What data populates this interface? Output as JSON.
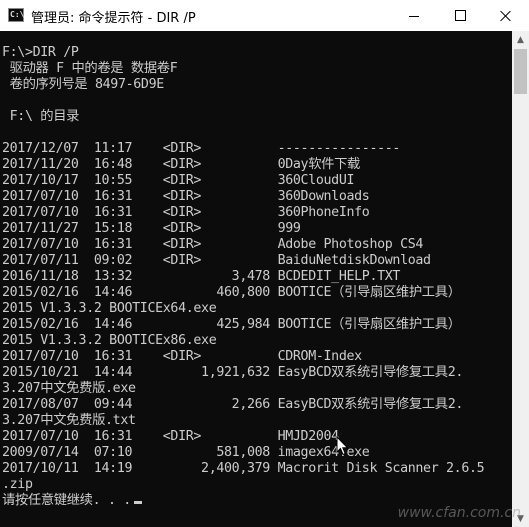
{
  "window": {
    "title": "管理员: 命令提示符 - DIR  /P",
    "icon": "cmd-icon",
    "icon_text": "C:\\",
    "min_icon": "minimize-icon",
    "max_icon": "maximize-icon",
    "close_icon": "close-icon"
  },
  "console": {
    "lines": [
      "F:\\>DIR /P",
      " 驱动器 F 中的卷是 数据卷F",
      " 卷的序列号是 8497-6D9E",
      "",
      " F:\\ 的目录",
      "",
      "2017/12/07  11:17    <DIR>          ----------------",
      "2017/11/20  16:48    <DIR>          0Day软件下载",
      "2017/10/17  10:55    <DIR>          360CloudUI",
      "2017/07/10  16:31    <DIR>          360Downloads",
      "2017/07/10  16:31    <DIR>          360PhoneInfo",
      "2017/11/27  15:18    <DIR>          999",
      "2017/07/10  16:31    <DIR>          Adobe Photoshop CS4",
      "2017/07/11  09:02    <DIR>          BaiduNetdiskDownload",
      "2016/11/18  13:32             3,478 BCDEDIT_HELP.TXT",
      "2015/02/16  14:46           460,800 BOOTICE（引导扇区维护工具）",
      "2015 V1.3.3.2 BOOTICEx64.exe",
      "2015/02/16  14:46           425,984 BOOTICE（引导扇区维护工具）",
      "2015 V1.3.3.2 BOOTICEx86.exe",
      "2017/07/10  16:31    <DIR>          CDROM-Index",
      "2015/10/21  14:44         1,921,632 EasyBCD双系统引导修复工具2.",
      "3.207中文免费版.exe",
      "2017/08/07  09:44             2,266 EasyBCD双系统引导修复工具2.",
      "3.207中文免费版.txt",
      "2017/07/10  16:31    <DIR>          HMJD2004",
      "2009/07/14  07:10           581,008 imagex64.exe",
      "2017/10/11  14:19         2,400,379 Macrorit Disk Scanner 2.6.5",
      ".zip",
      "请按任意键继续. . ."
    ]
  },
  "scrollbar": {
    "up_icon": "scroll-up-arrow-icon",
    "down_icon": "scroll-down-arrow-icon"
  },
  "watermark": "www.cfan.com.cn",
  "colors": {
    "console_bg": "#0c0c0c",
    "console_fg": "#cccccc",
    "titlebar_bg": "#ffffff"
  }
}
